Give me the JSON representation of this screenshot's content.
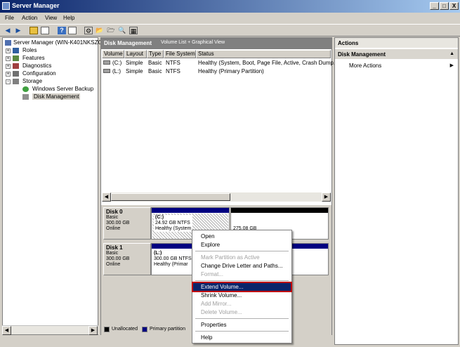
{
  "window": {
    "title": "Server Manager",
    "controls": [
      "_",
      "□",
      "X"
    ]
  },
  "menu": [
    "File",
    "Action",
    "View",
    "Help"
  ],
  "toolbar_icons": [
    "back-arrow-icon",
    "forward-arrow-icon",
    "up-folder-icon",
    "show-hide-tree-icon",
    "help-icon",
    "properties-icon",
    "settings-icon",
    "open-folder-icon",
    "magnifier-icon",
    "export-icon"
  ],
  "tree": {
    "root": "Server Manager (WIN-K401NKSZC",
    "items": [
      {
        "label": "Roles",
        "expander": "+"
      },
      {
        "label": "Features",
        "expander": "+"
      },
      {
        "label": "Diagnostics",
        "expander": "+"
      },
      {
        "label": "Configuration",
        "expander": "+"
      },
      {
        "label": "Storage",
        "expander": "-"
      }
    ],
    "storage_children": [
      "Windows Server Backup",
      "Disk Management"
    ]
  },
  "center": {
    "title": "Disk Management",
    "subtitle": "Volume List + Graphical View",
    "columns": [
      "Volume",
      "Layout",
      "Type",
      "File System",
      "Status"
    ],
    "rows": [
      {
        "volume": "(C:)",
        "layout": "Simple",
        "type": "Basic",
        "fs": "NTFS",
        "status": "Healthy (System, Boot, Page File, Active, Crash Dump,"
      },
      {
        "volume": "(L:)",
        "layout": "Simple",
        "type": "Basic",
        "fs": "NTFS",
        "status": "Healthy (Primary Partition)"
      }
    ]
  },
  "disks": [
    {
      "name": "Disk 0",
      "type": "Basic",
      "size": "300.00 GB",
      "state": "Online",
      "p1": {
        "name": "(C:)",
        "size": "24.92 GB NTFS",
        "status": "Healthy (System"
      },
      "p2": {
        "size": "275.08 GB",
        "status": ""
      }
    },
    {
      "name": "Disk 1",
      "type": "Basic",
      "size": "300.00 GB",
      "state": "Online",
      "p1": {
        "name": "(L:)",
        "size": "300.00 GB NTFS",
        "status": "Healthy (Primar"
      }
    }
  ],
  "legend": {
    "unallocated": "Unallocated",
    "primary": "Primary partition"
  },
  "actions": {
    "header": "Actions",
    "section": "Disk Management",
    "more": "More Actions"
  },
  "context_menu": {
    "open": "Open",
    "explore": "Explore",
    "mark_active": "Mark Partition as Active",
    "change_letter": "Change Drive Letter and Paths...",
    "format": "Format...",
    "extend": "Extend Volume...",
    "shrink": "Shrink Volume...",
    "add_mirror": "Add Mirror...",
    "delete": "Delete Volume...",
    "properties": "Properties",
    "help": "Help"
  },
  "colors": {
    "titlebar": "#0a246a",
    "primary_partition": "#000080",
    "unallocated": "#000000",
    "highlight_outline": "#c00000"
  }
}
